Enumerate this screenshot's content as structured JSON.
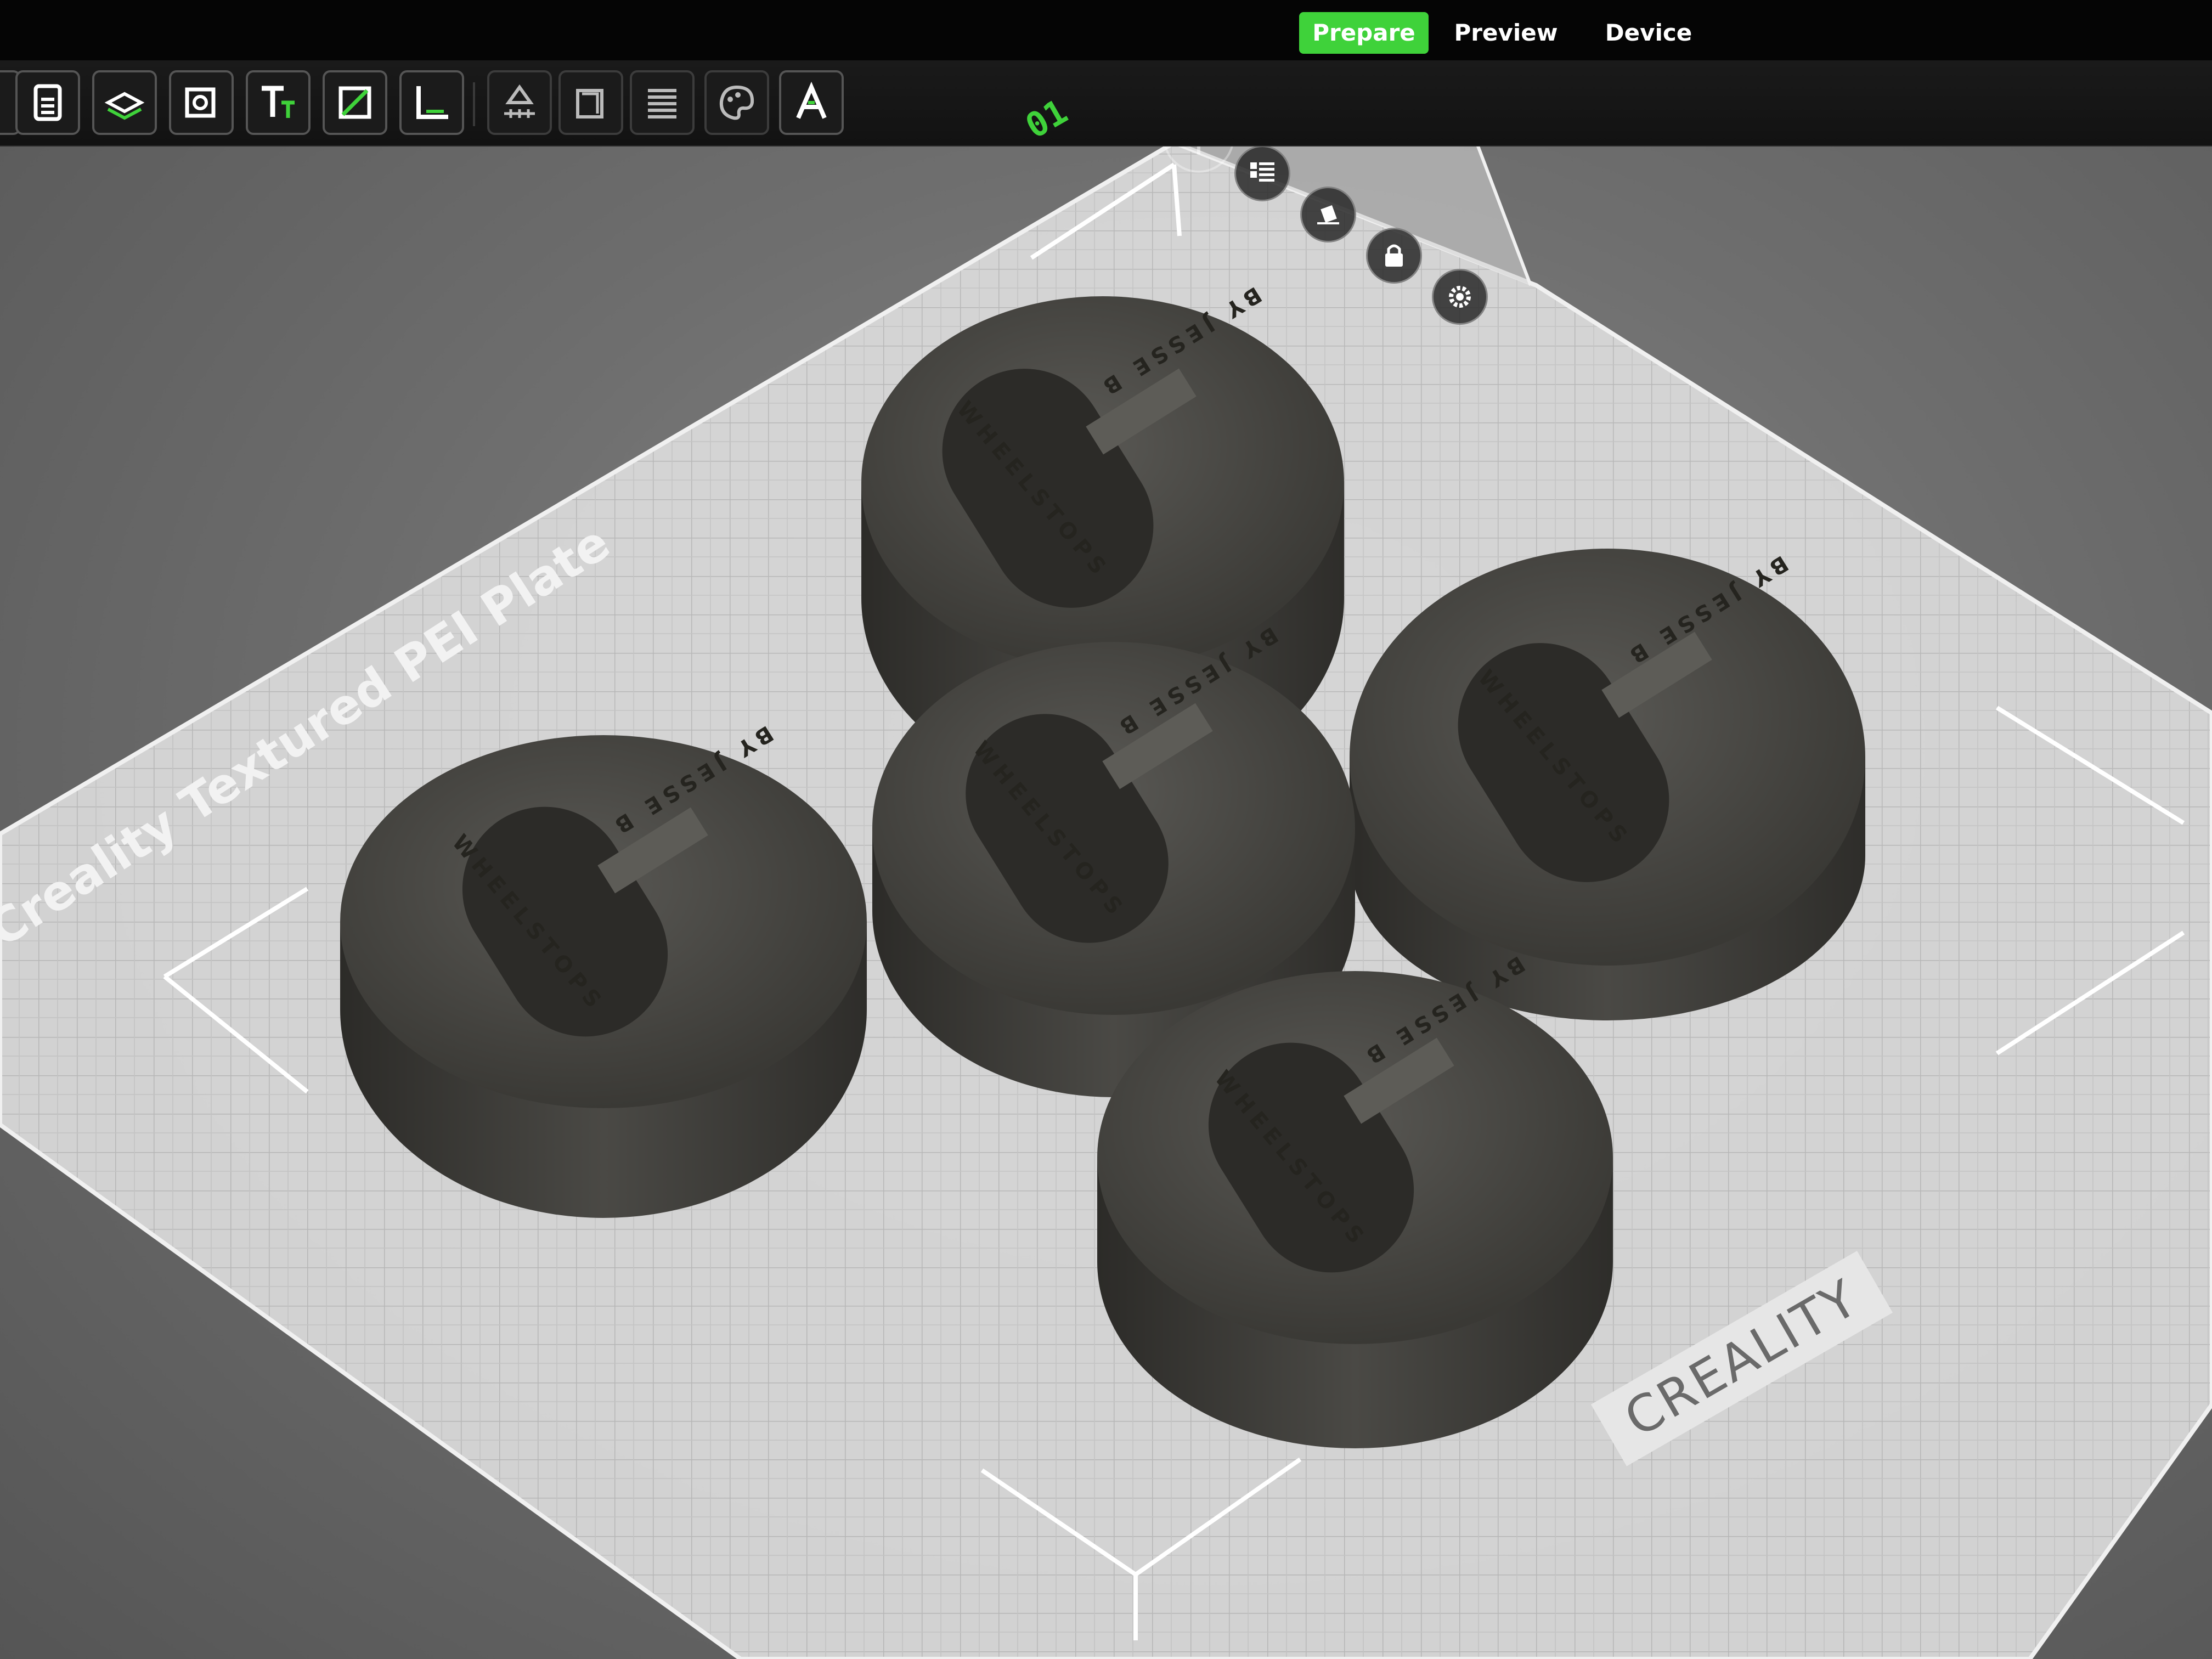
{
  "tabs": [
    {
      "label": "Prepare",
      "active": true
    },
    {
      "label": "Preview",
      "active": false
    },
    {
      "label": "Device",
      "active": false
    }
  ],
  "toolbar": {
    "icons": [
      "add-file-icon",
      "add-plate-icon",
      "auto-orient-icon",
      "text-icon",
      "cut-icon",
      "measure-icon",
      "support-icon",
      "assemble-icon",
      "layers-icon",
      "paint-icon",
      "emboss-text-icon"
    ]
  },
  "plate": {
    "number": "01",
    "name": "Creality Textured PEI Plate",
    "brand": "CREALITY",
    "tools": [
      "arrange-icon",
      "auto-orient-icon",
      "lock-icon",
      "settings-icon"
    ]
  },
  "parts": [
    {
      "top_text": "BY JESSE B",
      "bottom_text": "WHEELSTOPS"
    },
    {
      "top_text": "BY JESSE B",
      "bottom_text": "WHEELSTOPS"
    },
    {
      "top_text": "BY JESSE B",
      "bottom_text": "WHEELSTOPS"
    },
    {
      "top_text": "BY JESSE B",
      "bottom_text": "WHEELSTOPS"
    },
    {
      "top_text": "BY JESSE B",
      "bottom_text": "WHEELSTOPS"
    }
  ],
  "colors": {
    "accent": "#3fd23a",
    "topbar": "#050505",
    "plate": "#d9d9d9",
    "part": "#3b3a36"
  }
}
